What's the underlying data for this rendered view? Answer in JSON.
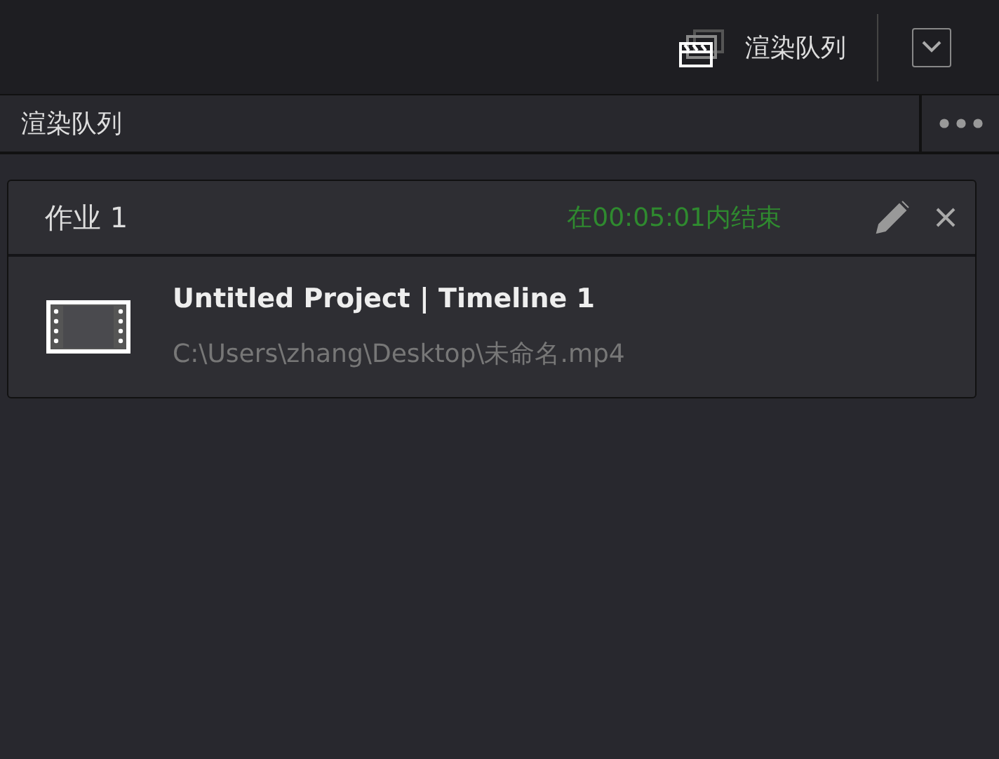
{
  "toolbar": {
    "label": "渲染队列"
  },
  "panel": {
    "title": "渲染队列"
  },
  "jobs": [
    {
      "name": "作业 1",
      "status": "在00:05:01内结束",
      "title": "Untitled Project | Timeline 1",
      "path": "C:\\Users\\zhang\\Desktop\\未命名.mp4"
    }
  ]
}
